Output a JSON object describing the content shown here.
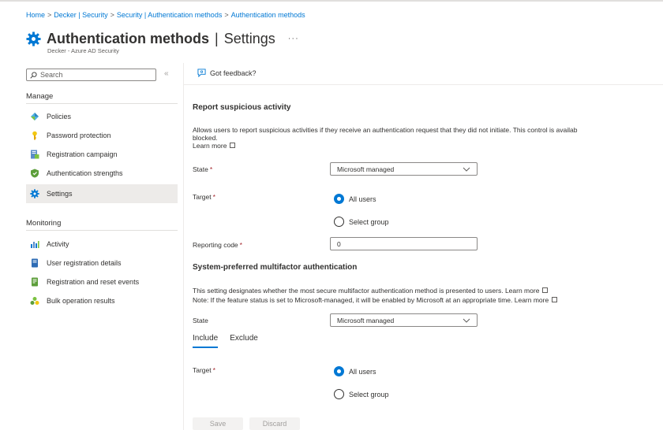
{
  "breadcrumb": {
    "items": [
      "Home",
      "Decker | Security",
      "Security | Authentication methods",
      "Authentication methods"
    ],
    "separator": ">"
  },
  "header": {
    "title_main": "Authentication methods",
    "title_divider": "|",
    "title_sub": "Settings",
    "more": "···",
    "subtitle": "Decker - Azure AD Security"
  },
  "sidebar": {
    "search_placeholder": "Search",
    "collapse": "«",
    "manage_heading": "Manage",
    "manage_items": [
      {
        "label": "Policies",
        "icon": "policies-icon"
      },
      {
        "label": "Password protection",
        "icon": "key-icon"
      },
      {
        "label": "Registration campaign",
        "icon": "registration-campaign-icon"
      },
      {
        "label": "Authentication strengths",
        "icon": "shield-icon"
      },
      {
        "label": "Settings",
        "icon": "gear-icon",
        "active": true
      }
    ],
    "monitoring_heading": "Monitoring",
    "monitoring_items": [
      {
        "label": "Activity",
        "icon": "activity-icon"
      },
      {
        "label": "User registration details",
        "icon": "user-registration-icon"
      },
      {
        "label": "Registration and reset events",
        "icon": "events-icon"
      },
      {
        "label": "Bulk operation results",
        "icon": "bulk-results-icon"
      }
    ]
  },
  "toolbar": {
    "feedback_label": "Got feedback?"
  },
  "report": {
    "heading": "Report suspicious activity",
    "desc_line1": "Allows users to report suspicious activities if they receive an authentication request that they did not initiate. This control is availab",
    "desc_line2": "blocked.",
    "learn_more": "Learn more",
    "state_label": "State",
    "state_value": "Microsoft managed",
    "target_label": "Target",
    "target_options": [
      "All users",
      "Select group"
    ],
    "reporting_code_label": "Reporting code",
    "reporting_code_value": "0",
    "required_mark": "*"
  },
  "mfa": {
    "heading": "System-preferred multifactor authentication",
    "desc_line1": "This setting designates whether the most secure multifactor authentication method is presented to users.",
    "desc_line2": "Note: If the feature status is set to Microsoft-managed, it will be enabled by Microsoft at an appropriate time.",
    "learn_more": "Learn more",
    "state_label": "State",
    "state_value": "Microsoft managed",
    "tabs": [
      "Include",
      "Exclude"
    ],
    "target_label": "Target",
    "target_options": [
      "All users",
      "Select group"
    ]
  },
  "actions": {
    "save": "Save",
    "discard": "Discard"
  },
  "colors": {
    "accent": "#0078d4",
    "active_nav": "#edebe9",
    "required": "#a4262c"
  }
}
